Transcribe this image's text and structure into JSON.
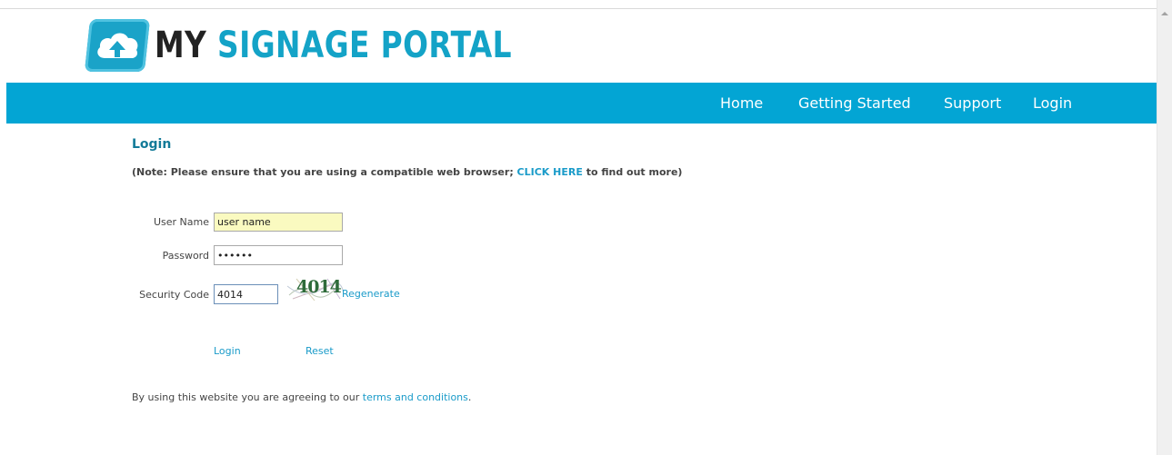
{
  "logo": {
    "part1": "MY",
    "part2": "SIGNAGE PORTAL",
    "icon": "cloud-upload-icon"
  },
  "nav": {
    "home": "Home",
    "getting_started": "Getting Started",
    "support": "Support",
    "login": "Login"
  },
  "main": {
    "title": "Login",
    "note_prefix": "(Note: Please ensure that you are using a compatible web browser; ",
    "note_link": "CLICK HERE",
    "note_suffix": " to find out more)"
  },
  "form": {
    "username_label": "User Name",
    "username_value": "user name",
    "password_label": "Password",
    "password_value": "secret",
    "security_label": "Security Code",
    "security_value": "4014",
    "captcha_text": "4014",
    "regenerate": "Regenerate",
    "login_button": "Login",
    "reset_button": "Reset"
  },
  "footer": {
    "terms_prefix": "By using this website you are agreeing to our ",
    "terms_link": "terms and conditions",
    "terms_suffix": "."
  },
  "colors": {
    "nav_bg": "#03a5d4",
    "brand": "#14a3c7",
    "link": "#1a9bc9",
    "title": "#127a98"
  }
}
